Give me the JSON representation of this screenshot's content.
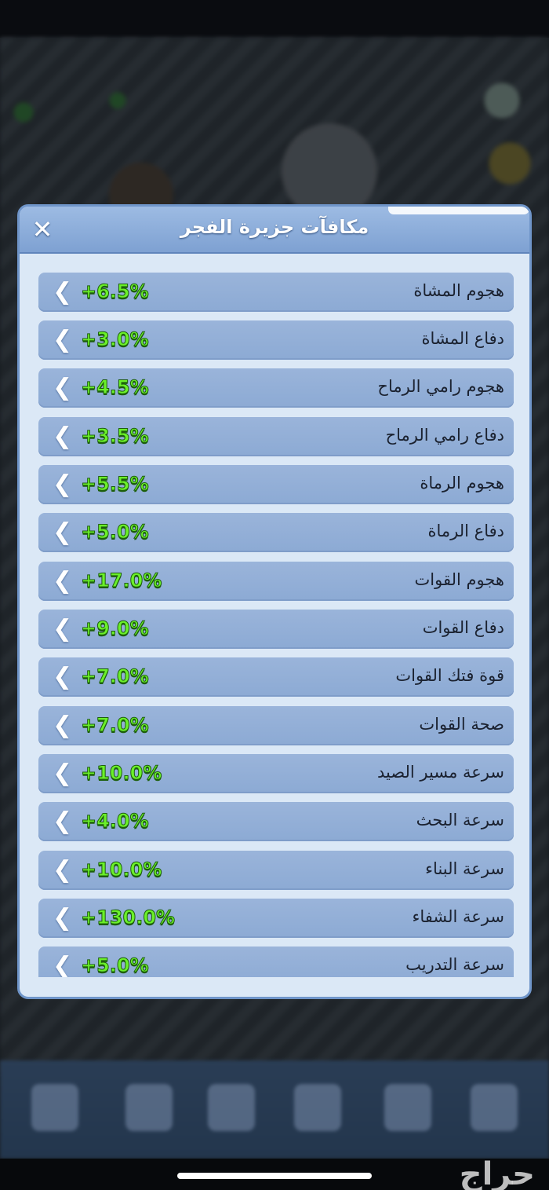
{
  "dialog": {
    "title": "مكافآت جزيرة الفجر",
    "close_icon": "close-icon",
    "items": [
      {
        "label": "هجوم المشاة",
        "value": "+6.5%"
      },
      {
        "label": "دفاع المشاة",
        "value": "+3.0%"
      },
      {
        "label": "هجوم رامي الرماح",
        "value": "+4.5%"
      },
      {
        "label": "دفاع رامي الرماح",
        "value": "+3.5%"
      },
      {
        "label": "هجوم الرماة",
        "value": "+5.5%"
      },
      {
        "label": "دفاع الرماة",
        "value": "+5.0%"
      },
      {
        "label": "هجوم القوات",
        "value": "+17.0%"
      },
      {
        "label": "دفاع القوات",
        "value": "+9.0%"
      },
      {
        "label": "قوة فتك القوات",
        "value": "+7.0%"
      },
      {
        "label": "صحة القوات",
        "value": "+7.0%"
      },
      {
        "label": "سرعة مسير الصيد",
        "value": "+10.0%"
      },
      {
        "label": "سرعة البحث",
        "value": "+4.0%"
      },
      {
        "label": "سرعة البناء",
        "value": "+10.0%"
      },
      {
        "label": "سرعة الشفاء",
        "value": "+130.0%"
      },
      {
        "label": "سرعة التدريب",
        "value": "+5.0%"
      }
    ]
  },
  "watermark": "حراج",
  "colors": {
    "value_green": "#6bf02a",
    "row_blue": "#8caad4",
    "header_blue": "#7ea1d2"
  }
}
